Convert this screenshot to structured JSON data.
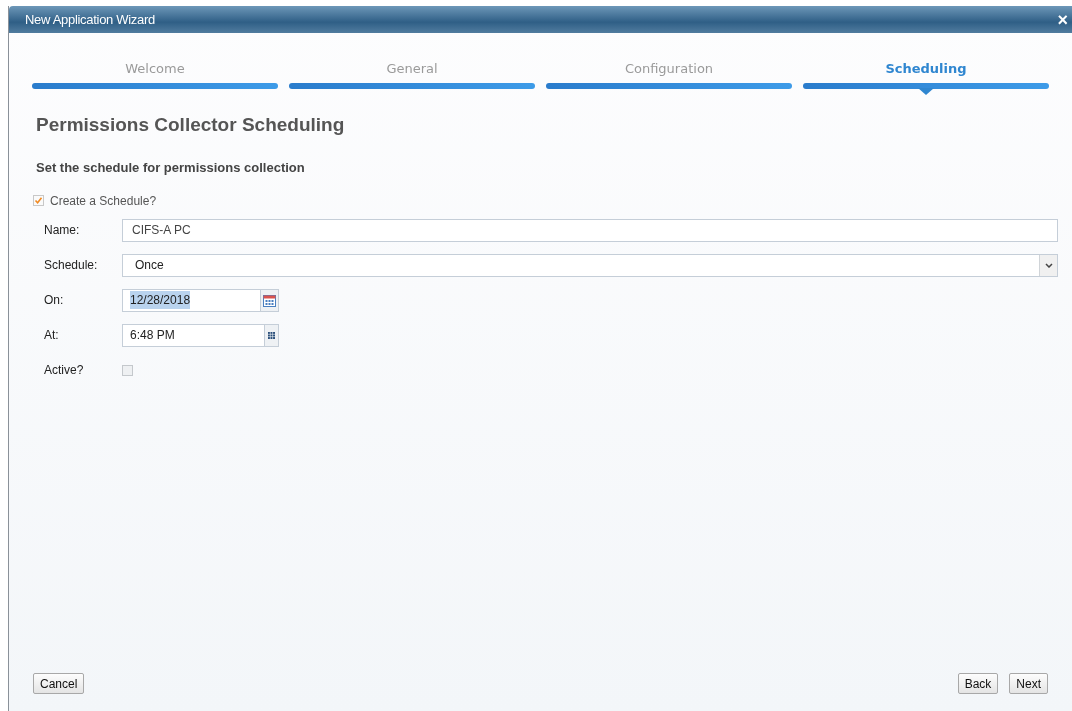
{
  "window": {
    "title": "New Application Wizard",
    "close": "×"
  },
  "steps": [
    {
      "label": "Welcome",
      "selected": false
    },
    {
      "label": "General",
      "selected": false
    },
    {
      "label": "Configuration",
      "selected": false
    },
    {
      "label": "Scheduling",
      "selected": true
    }
  ],
  "heading": "Permissions Collector Scheduling",
  "subheading": "Set the schedule for permissions collection",
  "create_schedule": {
    "label": "Create a Schedule?",
    "checked": true
  },
  "fields": [
    {
      "kind": "text",
      "label": "Name:",
      "value": "CIFS-A PC"
    },
    {
      "kind": "select",
      "label": "Schedule:",
      "value": "Once"
    },
    {
      "kind": "date",
      "label": "On:",
      "value": "12/28/2018",
      "highlighted": true
    },
    {
      "kind": "time",
      "label": "At:",
      "value": "6:48 PM"
    },
    {
      "kind": "checkbox",
      "label": "Active?",
      "checked": false
    }
  ],
  "buttons": {
    "left": [
      "Cancel"
    ],
    "right": [
      "Back",
      "Next"
    ]
  }
}
